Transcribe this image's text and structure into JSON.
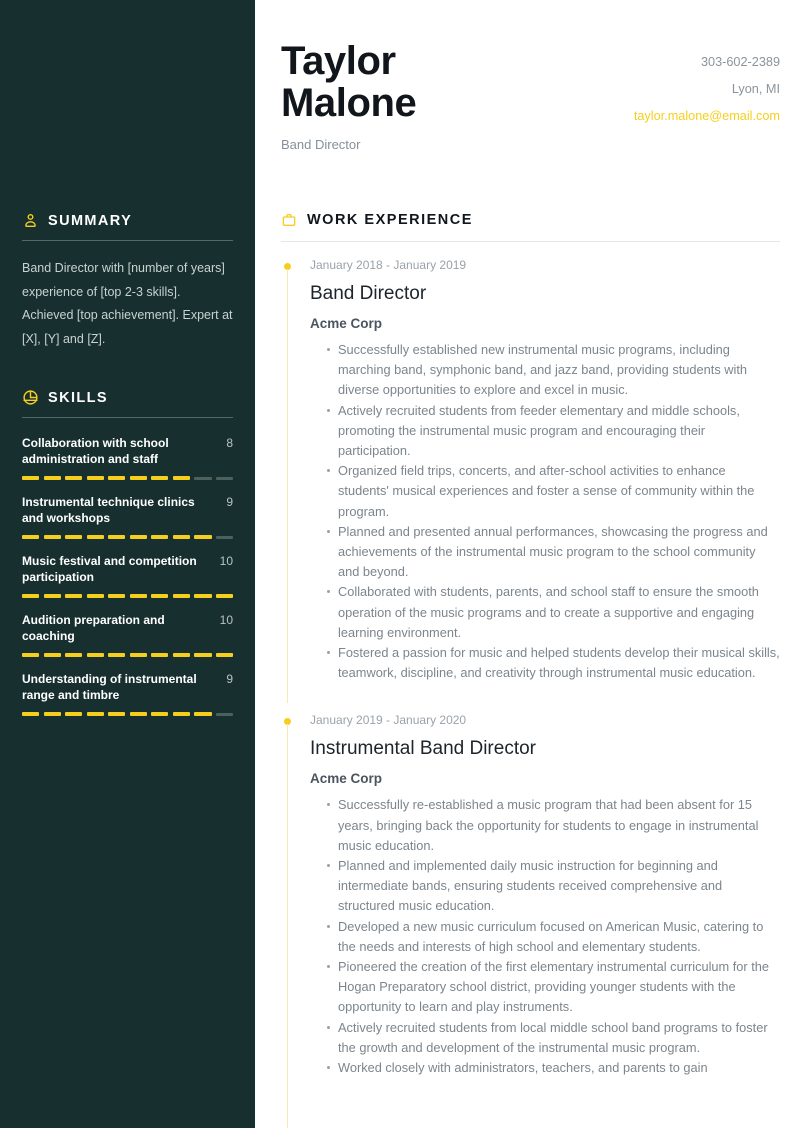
{
  "header": {
    "first_name": "Taylor",
    "last_name": "Malone",
    "job_subtitle": "Band Director",
    "phone": "303-602-2389",
    "location": "Lyon, MI",
    "email": "taylor.malone@email.com"
  },
  "colors": {
    "sidebar_background": "#17302f",
    "accent": "#f6cf1e",
    "accent_light": "#fbebaa",
    "body_text": "#7c858d",
    "heading_text": "#10161c"
  },
  "sidebar": {
    "summary": {
      "icon": "person-icon",
      "heading": "SUMMARY",
      "text": "Band Director with [number of years] experience of [top 2-3 skills]. Achieved [top achievement]. Expert at [X], [Y] and [Z]."
    },
    "skills": {
      "icon": "target-icon",
      "heading": "SKILLS",
      "max_score": 10,
      "items": [
        {
          "name": "Collaboration with school administration and staff",
          "score": 8
        },
        {
          "name": "Instrumental technique clinics and workshops",
          "score": 9
        },
        {
          "name": "Music festival and competition participation",
          "score": 10
        },
        {
          "name": "Audition preparation and coaching",
          "score": 10
        },
        {
          "name": "Understanding of instrumental range and timbre",
          "score": 9
        }
      ]
    }
  },
  "main": {
    "work_experience": {
      "icon": "briefcase-icon",
      "heading": "WORK EXPERIENCE",
      "entries": [
        {
          "date": "January 2018 - January 2019",
          "title": "Band Director",
          "company": "Acme Corp",
          "bullets": [
            "Successfully established new instrumental music programs, including marching band, symphonic band, and jazz band, providing students with diverse opportunities to explore and excel in music.",
            "Actively recruited students from feeder elementary and middle schools, promoting the instrumental music program and encouraging their participation.",
            "Organized field trips, concerts, and after-school activities to enhance students' musical experiences and foster a sense of community within the program.",
            "Planned and presented annual performances, showcasing the progress and achievements of the instrumental music program to the school community and beyond.",
            "Collaborated with students, parents, and school staff to ensure the smooth operation of the music programs and to create a supportive and engaging learning environment.",
            "Fostered a passion for music and helped students develop their musical skills, teamwork, discipline, and creativity through instrumental music education."
          ]
        },
        {
          "date": "January 2019 - January 2020",
          "title": "Instrumental Band Director",
          "company": "Acme Corp",
          "bullets": [
            "Successfully re-established a music program that had been absent for 15 years, bringing back the opportunity for students to engage in instrumental music education.",
            "Planned and implemented daily music instruction for beginning and intermediate bands, ensuring students received comprehensive and structured music education.",
            "Developed a new music curriculum focused on American Music, catering to the needs and interests of high school and elementary students.",
            "Pioneered the creation of the first elementary instrumental curriculum for the Hogan Preparatory school district, providing younger students with the opportunity to learn and play instruments.",
            "Actively recruited students from local middle school band programs to foster the growth and development of the instrumental music program.",
            "Worked closely with administrators, teachers, and parents to gain"
          ]
        }
      ]
    }
  }
}
